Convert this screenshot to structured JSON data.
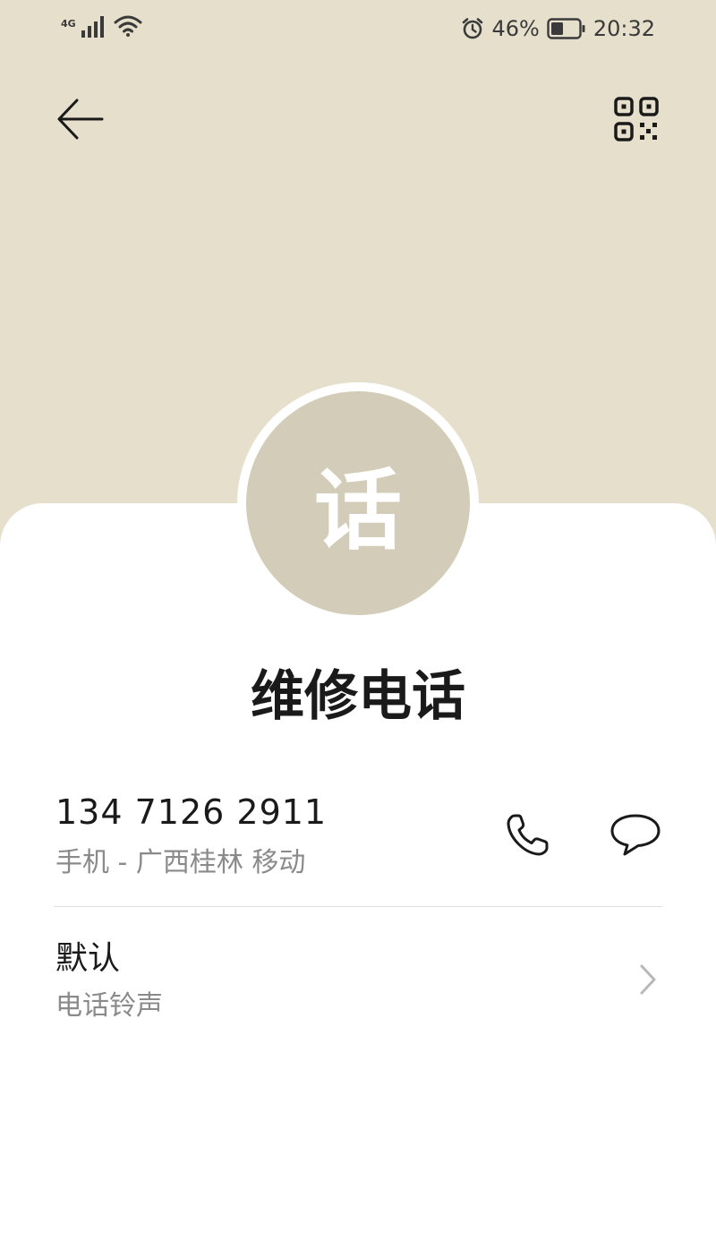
{
  "status_bar": {
    "network_type": "4G",
    "battery_percent": "46%",
    "battery_level": 0.46,
    "time": "20:32"
  },
  "header": {
    "back_icon": "arrow-left-icon",
    "qr_icon": "qr-code-icon",
    "background_color": "#e6dfcc"
  },
  "contact": {
    "avatar_text": "话",
    "avatar_color": "#d3ccb8",
    "name": "维修电话"
  },
  "phone_entry": {
    "number": "134 7126 2911",
    "meta": "手机 - 广西桂林 移动",
    "call_icon": "phone-icon",
    "message_icon": "message-bubble-icon"
  },
  "ringtone": {
    "value": "默认",
    "label": "电话铃声",
    "chevron_icon": "chevron-right-icon"
  }
}
